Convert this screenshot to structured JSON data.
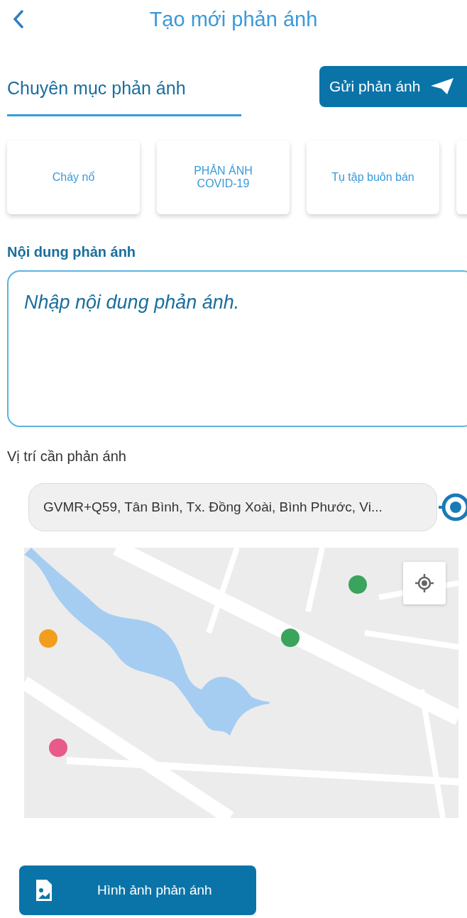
{
  "header": {
    "title": "Tạo mới phản ánh"
  },
  "section": {
    "title": "Chuyên mục phản ánh",
    "send_button": "Gửi phản ánh"
  },
  "categories": [
    {
      "label": "Cháy nổ"
    },
    {
      "label": "PHẢN ÁNH COVID-19"
    },
    {
      "label": "Tụ tập buôn bán"
    }
  ],
  "content": {
    "label": "Nội dung phản ánh",
    "placeholder": "Nhập nội dung phản ánh."
  },
  "location": {
    "label": "Vị trí cần phản ánh",
    "address": "GVMR+Q59, Tân Bình, Tx. Đồng Xoài, Bình Phước, Vi..."
  },
  "image_button": "Hình ảnh phản ánh"
}
